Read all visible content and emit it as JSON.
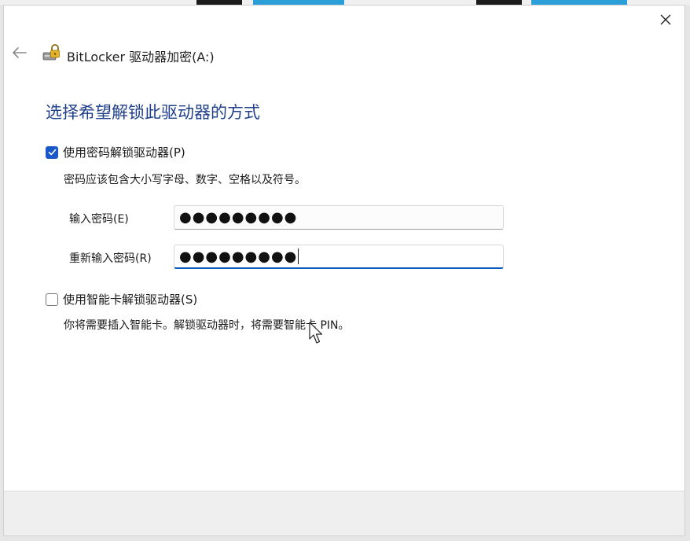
{
  "window": {
    "title": "BitLocker 驱动器加密(A:)",
    "heading": "选择希望解锁此驱动器的方式"
  },
  "password_option": {
    "label": "使用密码解锁驱动器(P)",
    "checked": true,
    "description": "密码应该包含大小写字母、数字、空格以及符号。",
    "enter_label": "输入密码(E)",
    "enter_value": "●●●●●●●●●",
    "reenter_label": "重新输入密码(R)",
    "reenter_value": "●●●●●●●●●"
  },
  "smartcard_option": {
    "label": "使用智能卡解锁驱动器(S)",
    "checked": false,
    "description": "你将需要插入智能卡。解锁驱动器时，将需要智能卡 PIN。"
  },
  "colors": {
    "accent": "#1a58c7",
    "heading": "#1f3f8a",
    "focus_underline": "#0c5bb7"
  },
  "icons": [
    "close-icon",
    "back-arrow-icon",
    "bitlocker-drive-icon",
    "checkmark-icon",
    "mouse-pointer-icon"
  ]
}
